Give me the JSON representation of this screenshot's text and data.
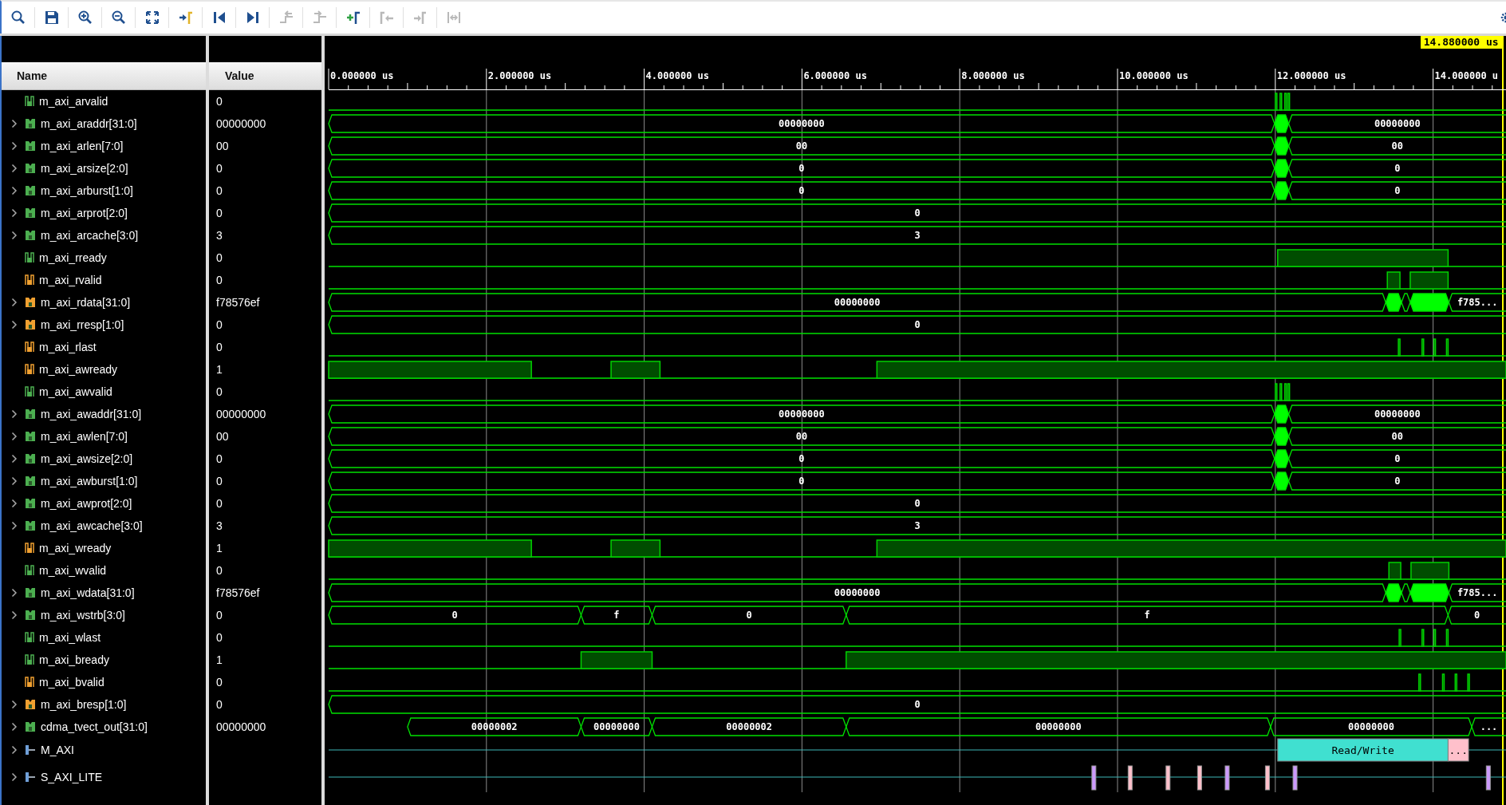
{
  "toolbar": [
    {
      "kind": "search",
      "disabled": false
    },
    {
      "kind": "save",
      "disabled": false
    },
    {
      "kind": "zoom-in",
      "disabled": false
    },
    {
      "kind": "zoom-out",
      "disabled": false
    },
    {
      "kind": "zoom-fit",
      "disabled": false
    },
    {
      "kind": "go-to-cursor",
      "disabled": false
    },
    {
      "kind": "go-to-start",
      "disabled": false
    },
    {
      "kind": "go-to-end",
      "disabled": false
    },
    {
      "kind": "previous-transition",
      "disabled": true
    },
    {
      "kind": "next-transition",
      "disabled": true
    },
    {
      "kind": "add-marker",
      "disabled": false
    },
    {
      "kind": "previous-marker",
      "disabled": true
    },
    {
      "kind": "next-marker",
      "disabled": true
    },
    {
      "kind": "swap-cursors",
      "disabled": true
    }
  ],
  "columns": [
    "Name",
    "Value"
  ],
  "cursor": {
    "time": "14.880000 us"
  },
  "ruler": {
    "labels": [
      "0.000000 us",
      "2.000000 us",
      "4.000000 us",
      "6.000000 us",
      "8.000000 us",
      "10.000000 us",
      "12.000000 us",
      "14.000000 u"
    ]
  },
  "signals": [
    {
      "name": "m_axi_arvalid",
      "value": "0",
      "kind": "bit",
      "color": "#4caf50"
    },
    {
      "name": "m_axi_araddr[31:0]",
      "value": "00000000",
      "kind": "bus",
      "color": "#4caf50",
      "expanded": false,
      "wave_values": [
        "00000000",
        "00000000"
      ]
    },
    {
      "name": "m_axi_arlen[7:0]",
      "value": "00",
      "kind": "bus",
      "color": "#4caf50",
      "expanded": false,
      "wave_values": [
        "00",
        "00"
      ]
    },
    {
      "name": "m_axi_arsize[2:0]",
      "value": "0",
      "kind": "bus",
      "color": "#4caf50",
      "expanded": false,
      "wave_values": [
        "0",
        "0"
      ]
    },
    {
      "name": "m_axi_arburst[1:0]",
      "value": "0",
      "kind": "bus",
      "color": "#4caf50",
      "expanded": false,
      "wave_values": [
        "0",
        "0"
      ]
    },
    {
      "name": "m_axi_arprot[2:0]",
      "value": "0",
      "kind": "bus",
      "color": "#4caf50",
      "expanded": false,
      "wave_values": [
        "0"
      ]
    },
    {
      "name": "m_axi_arcache[3:0]",
      "value": "3",
      "kind": "bus",
      "color": "#4caf50",
      "expanded": false,
      "wave_values": [
        "3"
      ]
    },
    {
      "name": "m_axi_rready",
      "value": "0",
      "kind": "bit",
      "color": "#4caf50"
    },
    {
      "name": "m_axi_rvalid",
      "value": "0",
      "kind": "bit",
      "color": "#f0a030"
    },
    {
      "name": "m_axi_rdata[31:0]",
      "value": "f78576ef",
      "kind": "bus",
      "color": "#f0a030",
      "expanded": false,
      "wave_values": [
        "00000000",
        "f785..."
      ]
    },
    {
      "name": "m_axi_rresp[1:0]",
      "value": "0",
      "kind": "bus",
      "color": "#f0a030",
      "expanded": false,
      "wave_values": [
        "0"
      ]
    },
    {
      "name": "m_axi_rlast",
      "value": "0",
      "kind": "bit",
      "color": "#f0a030"
    },
    {
      "name": "m_axi_awready",
      "value": "1",
      "kind": "bit",
      "color": "#f0a030"
    },
    {
      "name": "m_axi_awvalid",
      "value": "0",
      "kind": "bit",
      "color": "#4caf50"
    },
    {
      "name": "m_axi_awaddr[31:0]",
      "value": "00000000",
      "kind": "bus",
      "color": "#4caf50",
      "expanded": false,
      "wave_values": [
        "00000000",
        "00000000"
      ]
    },
    {
      "name": "m_axi_awlen[7:0]",
      "value": "00",
      "kind": "bus",
      "color": "#4caf50",
      "expanded": false,
      "wave_values": [
        "00",
        "00"
      ]
    },
    {
      "name": "m_axi_awsize[2:0]",
      "value": "0",
      "kind": "bus",
      "color": "#4caf50",
      "expanded": false,
      "wave_values": [
        "0",
        "0"
      ]
    },
    {
      "name": "m_axi_awburst[1:0]",
      "value": "0",
      "kind": "bus",
      "color": "#4caf50",
      "expanded": false,
      "wave_values": [
        "0",
        "0"
      ]
    },
    {
      "name": "m_axi_awprot[2:0]",
      "value": "0",
      "kind": "bus",
      "color": "#4caf50",
      "expanded": false,
      "wave_values": [
        "0"
      ]
    },
    {
      "name": "m_axi_awcache[3:0]",
      "value": "3",
      "kind": "bus",
      "color": "#4caf50",
      "expanded": false,
      "wave_values": [
        "3"
      ]
    },
    {
      "name": "m_axi_wready",
      "value": "1",
      "kind": "bit",
      "color": "#f0a030"
    },
    {
      "name": "m_axi_wvalid",
      "value": "0",
      "kind": "bit",
      "color": "#4caf50"
    },
    {
      "name": "m_axi_wdata[31:0]",
      "value": "f78576ef",
      "kind": "bus",
      "color": "#4caf50",
      "expanded": false,
      "wave_values": [
        "00000000",
        "f785..."
      ]
    },
    {
      "name": "m_axi_wstrb[3:0]",
      "value": "0",
      "kind": "bus",
      "color": "#4caf50",
      "expanded": false,
      "wave_values": [
        "0",
        "f",
        "0",
        "f",
        "0"
      ]
    },
    {
      "name": "m_axi_wlast",
      "value": "0",
      "kind": "bit",
      "color": "#4caf50"
    },
    {
      "name": "m_axi_bready",
      "value": "1",
      "kind": "bit",
      "color": "#4caf50"
    },
    {
      "name": "m_axi_bvalid",
      "value": "0",
      "kind": "bit",
      "color": "#f0a030"
    },
    {
      "name": "m_axi_bresp[1:0]",
      "value": "0",
      "kind": "bus",
      "color": "#f0a030",
      "expanded": false,
      "wave_values": [
        "0"
      ]
    },
    {
      "name": "cdma_tvect_out[31:0]",
      "value": "00000000",
      "kind": "bus",
      "color": "#4caf50",
      "expanded": false,
      "wave_values": [
        "00000002",
        "00000000",
        "00000002",
        "00000000",
        "00000000",
        "..."
      ]
    },
    {
      "name": "M_AXI",
      "kind": "interface",
      "color": "#6f9fd8",
      "expanded": false,
      "transactions": [
        {
          "label": "Read/Write",
          "color": "#40e0d0"
        },
        {
          "label": "...",
          "color": "#ffc0cb"
        }
      ]
    },
    {
      "name": "S_AXI_LITE",
      "kind": "interface",
      "color": "#6f9fd8",
      "expanded": false,
      "markers": [
        {
          "color": "#cc99ff"
        },
        {
          "color": "#ffc0cb"
        },
        {
          "color": "#ffc0cb"
        },
        {
          "color": "#ffc0cb"
        },
        {
          "color": "#cc99ff"
        },
        {
          "color": "#ffc0cb"
        },
        {
          "color": "#cc99ff"
        },
        {
          "color": "#cc99ff"
        }
      ]
    }
  ]
}
